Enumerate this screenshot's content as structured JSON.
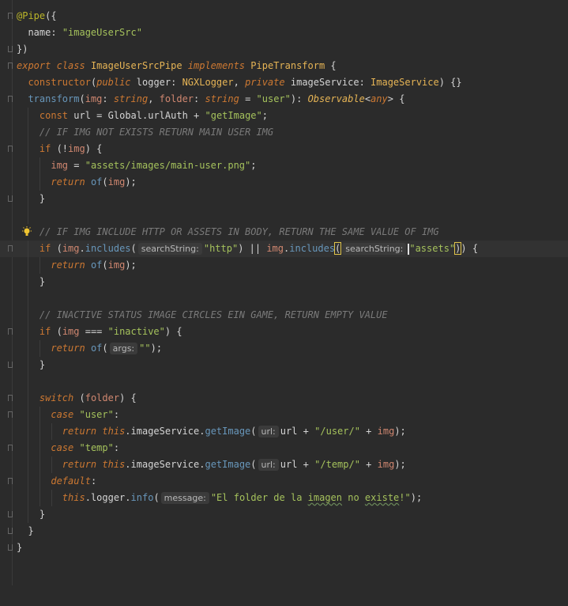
{
  "lines": [
    "@Pipe({",
    "  name: \"imageUserSrc\"",
    "})",
    "export class ImageUserSrcPipe implements PipeTransform {",
    "  constructor(public logger: NGXLogger, private imageService: ImageService) {}",
    "  transform(img: string, folder: string = \"user\"): Observable<any> {",
    "    const url = Global.urlAuth + \"getImage\";",
    "    // IF IMG NOT EXISTS RETURN MAIN USER IMG",
    "    if (!img) {",
    "      img = \"assets/images/main-user.png\";",
    "      return of(img);",
    "    }",
    "",
    "    // IF IMG INCLUDE HTTP OR ASSETS IN BODY, RETURN THE SAME VALUE OF IMG",
    "    if (img.includes( searchString: \"http\") || img.includes( searchString: \"assets\")) {",
    "      return of(img);",
    "    }",
    "",
    "    // INACTIVE STATUS IMAGE CIRCLES EIN GAME, RETURN EMPTY VALUE",
    "    if (img === \"inactive\") {",
    "      return of( args: \"\");",
    "    }",
    "",
    "    switch (folder) {",
    "      case \"user\":",
    "        return this.imageService.getImage( url: url + \"/user/\" + img);",
    "      case \"temp\":",
    "        return this.imageService.getImage( url: url + \"/temp/\" + img);",
    "      default:",
    "        this.logger.info( message: \"El folder de la imagen no existe!\");",
    "    }",
    "  }",
    "}"
  ],
  "tokens": {
    "pipe_dec": "@Pipe",
    "name_key": "name",
    "name_val": "\"imageUserSrc\"",
    "export": "export",
    "class": "class",
    "class_name": "ImageUserSrcPipe",
    "implements": "implements",
    "pipe_transform": "PipeTransform",
    "constructor": "constructor",
    "public": "public",
    "logger": "logger",
    "ngx_logger": "NGXLogger",
    "private": "private",
    "image_service_prop": "imageService",
    "image_service_type": "ImageService",
    "transform": "transform",
    "img": "img",
    "string": "string",
    "folder": "folder",
    "user_str": "\"user\"",
    "observable": "Observable",
    "any": "any",
    "const": "const",
    "url": "url",
    "global": "Global",
    "url_auth": "urlAuth",
    "get_image_str": "\"getImage\"",
    "comment1": "// IF IMG NOT EXISTS RETURN MAIN USER IMG",
    "if": "if",
    "main_user_str": "\"assets/images/main-user.png\"",
    "return": "return",
    "of": "of",
    "comment2": "// IF IMG INCLUDE HTTP OR ASSETS IN BODY, RETURN THE SAME VALUE OF IMG",
    "includes": "includes",
    "hint_search": "searchString:",
    "http_str": "\"http\"",
    "assets_str": "\"assets\"",
    "comment3": "// INACTIVE STATUS IMAGE CIRCLES EIN GAME, RETURN EMPTY VALUE",
    "inactive_str": "\"inactive\"",
    "hint_args": "args:",
    "empty_str": "\"\"",
    "switch": "switch",
    "case": "case",
    "temp_str": "\"temp\"",
    "this": "this",
    "get_image": "getImage",
    "hint_url": "url:",
    "user_path": "\"/user/\"",
    "temp_path": "\"/temp/\"",
    "default": "default",
    "info": "info",
    "hint_message": "message:",
    "msg_part1": "\"El folder de la ",
    "msg_imagen": "imagen",
    "msg_no": " no ",
    "msg_existe": "existe",
    "msg_end": "!\""
  },
  "colors": {
    "background": "#2b2b2b",
    "current_line": "#323232",
    "keyword": "#cc7832",
    "string": "#a5c25c",
    "comment": "#7a7a7a",
    "decorator": "#bbb529",
    "class": "#e6b455"
  },
  "icons": {
    "intention_bulb": "lightbulb-icon"
  }
}
